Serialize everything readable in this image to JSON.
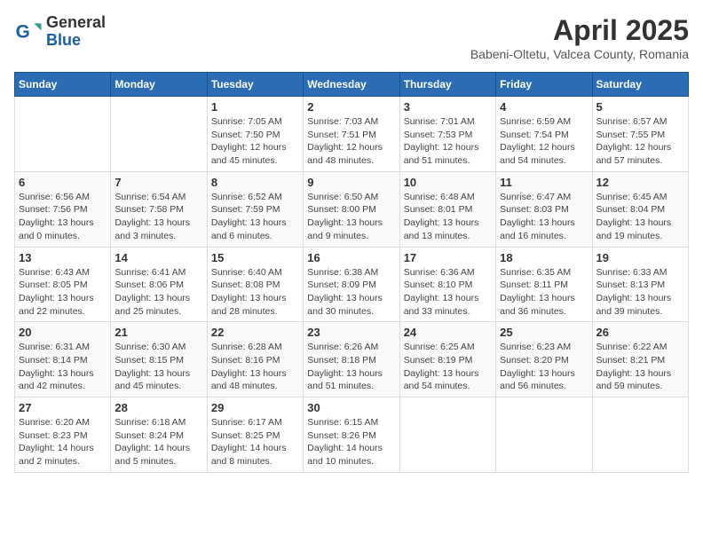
{
  "header": {
    "logo_general": "General",
    "logo_blue": "Blue",
    "month_year": "April 2025",
    "location": "Babeni-Oltetu, Valcea County, Romania"
  },
  "days_of_week": [
    "Sunday",
    "Monday",
    "Tuesday",
    "Wednesday",
    "Thursday",
    "Friday",
    "Saturday"
  ],
  "weeks": [
    [
      {
        "day": "",
        "info": ""
      },
      {
        "day": "",
        "info": ""
      },
      {
        "day": "1",
        "info": "Sunrise: 7:05 AM\nSunset: 7:50 PM\nDaylight: 12 hours and 45 minutes."
      },
      {
        "day": "2",
        "info": "Sunrise: 7:03 AM\nSunset: 7:51 PM\nDaylight: 12 hours and 48 minutes."
      },
      {
        "day": "3",
        "info": "Sunrise: 7:01 AM\nSunset: 7:53 PM\nDaylight: 12 hours and 51 minutes."
      },
      {
        "day": "4",
        "info": "Sunrise: 6:59 AM\nSunset: 7:54 PM\nDaylight: 12 hours and 54 minutes."
      },
      {
        "day": "5",
        "info": "Sunrise: 6:57 AM\nSunset: 7:55 PM\nDaylight: 12 hours and 57 minutes."
      }
    ],
    [
      {
        "day": "6",
        "info": "Sunrise: 6:56 AM\nSunset: 7:56 PM\nDaylight: 13 hours and 0 minutes."
      },
      {
        "day": "7",
        "info": "Sunrise: 6:54 AM\nSunset: 7:58 PM\nDaylight: 13 hours and 3 minutes."
      },
      {
        "day": "8",
        "info": "Sunrise: 6:52 AM\nSunset: 7:59 PM\nDaylight: 13 hours and 6 minutes."
      },
      {
        "day": "9",
        "info": "Sunrise: 6:50 AM\nSunset: 8:00 PM\nDaylight: 13 hours and 9 minutes."
      },
      {
        "day": "10",
        "info": "Sunrise: 6:48 AM\nSunset: 8:01 PM\nDaylight: 13 hours and 13 minutes."
      },
      {
        "day": "11",
        "info": "Sunrise: 6:47 AM\nSunset: 8:03 PM\nDaylight: 13 hours and 16 minutes."
      },
      {
        "day": "12",
        "info": "Sunrise: 6:45 AM\nSunset: 8:04 PM\nDaylight: 13 hours and 19 minutes."
      }
    ],
    [
      {
        "day": "13",
        "info": "Sunrise: 6:43 AM\nSunset: 8:05 PM\nDaylight: 13 hours and 22 minutes."
      },
      {
        "day": "14",
        "info": "Sunrise: 6:41 AM\nSunset: 8:06 PM\nDaylight: 13 hours and 25 minutes."
      },
      {
        "day": "15",
        "info": "Sunrise: 6:40 AM\nSunset: 8:08 PM\nDaylight: 13 hours and 28 minutes."
      },
      {
        "day": "16",
        "info": "Sunrise: 6:38 AM\nSunset: 8:09 PM\nDaylight: 13 hours and 30 minutes."
      },
      {
        "day": "17",
        "info": "Sunrise: 6:36 AM\nSunset: 8:10 PM\nDaylight: 13 hours and 33 minutes."
      },
      {
        "day": "18",
        "info": "Sunrise: 6:35 AM\nSunset: 8:11 PM\nDaylight: 13 hours and 36 minutes."
      },
      {
        "day": "19",
        "info": "Sunrise: 6:33 AM\nSunset: 8:13 PM\nDaylight: 13 hours and 39 minutes."
      }
    ],
    [
      {
        "day": "20",
        "info": "Sunrise: 6:31 AM\nSunset: 8:14 PM\nDaylight: 13 hours and 42 minutes."
      },
      {
        "day": "21",
        "info": "Sunrise: 6:30 AM\nSunset: 8:15 PM\nDaylight: 13 hours and 45 minutes."
      },
      {
        "day": "22",
        "info": "Sunrise: 6:28 AM\nSunset: 8:16 PM\nDaylight: 13 hours and 48 minutes."
      },
      {
        "day": "23",
        "info": "Sunrise: 6:26 AM\nSunset: 8:18 PM\nDaylight: 13 hours and 51 minutes."
      },
      {
        "day": "24",
        "info": "Sunrise: 6:25 AM\nSunset: 8:19 PM\nDaylight: 13 hours and 54 minutes."
      },
      {
        "day": "25",
        "info": "Sunrise: 6:23 AM\nSunset: 8:20 PM\nDaylight: 13 hours and 56 minutes."
      },
      {
        "day": "26",
        "info": "Sunrise: 6:22 AM\nSunset: 8:21 PM\nDaylight: 13 hours and 59 minutes."
      }
    ],
    [
      {
        "day": "27",
        "info": "Sunrise: 6:20 AM\nSunset: 8:23 PM\nDaylight: 14 hours and 2 minutes."
      },
      {
        "day": "28",
        "info": "Sunrise: 6:18 AM\nSunset: 8:24 PM\nDaylight: 14 hours and 5 minutes."
      },
      {
        "day": "29",
        "info": "Sunrise: 6:17 AM\nSunset: 8:25 PM\nDaylight: 14 hours and 8 minutes."
      },
      {
        "day": "30",
        "info": "Sunrise: 6:15 AM\nSunset: 8:26 PM\nDaylight: 14 hours and 10 minutes."
      },
      {
        "day": "",
        "info": ""
      },
      {
        "day": "",
        "info": ""
      },
      {
        "day": "",
        "info": ""
      }
    ]
  ]
}
